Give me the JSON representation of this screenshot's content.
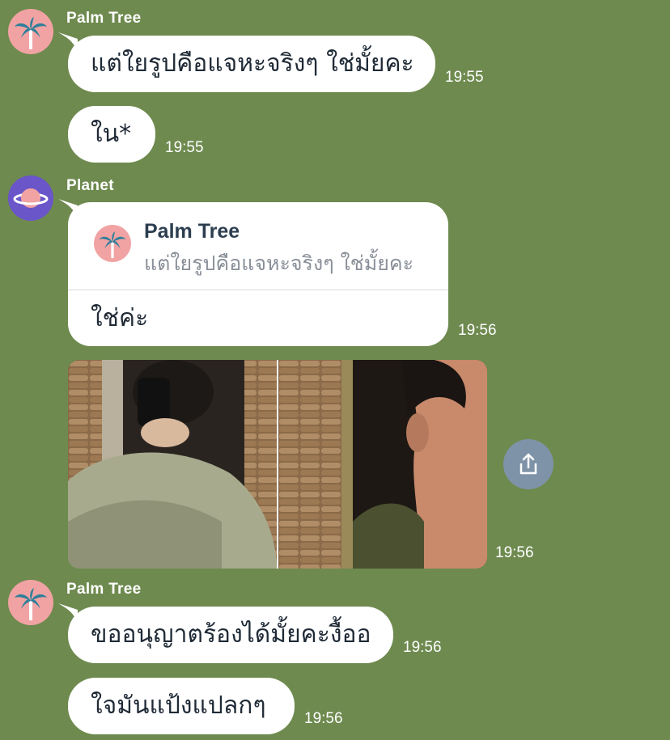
{
  "messages": [
    {
      "sender": "Palm Tree",
      "text": "แต่ใยรูปคือแจหะจริงๆ ใช่มั้ยคะ",
      "time": "19:55"
    },
    {
      "text": "ใน*",
      "time": "19:55"
    },
    {
      "sender": "Planet",
      "quote": {
        "name": "Palm Tree",
        "text": "แต่ใยรูปคือแจหะจริงๆ ใช่มั้ยคะ"
      },
      "text": "ใช่ค่ะ",
      "time": "19:56"
    },
    {
      "photo_time": "19:56"
    },
    {
      "sender": "Palm Tree",
      "text": "ขออนุญาตร้องได้มั้ยคะงื้ออ",
      "time": "19:56"
    },
    {
      "text": "ใจมันแป้งแปลกๆ",
      "time": "19:56"
    }
  ],
  "icons": {
    "palm_avatar": "palm-tree-icon",
    "planet_avatar": "planet-icon",
    "share": "share-icon"
  },
  "colors": {
    "background": "#6e8a4f",
    "bubble": "#ffffff",
    "palm_avatar_bg": "#f1a3a3",
    "planet_avatar_bg": "#6a55c9",
    "share_button": "#7f93a8"
  }
}
